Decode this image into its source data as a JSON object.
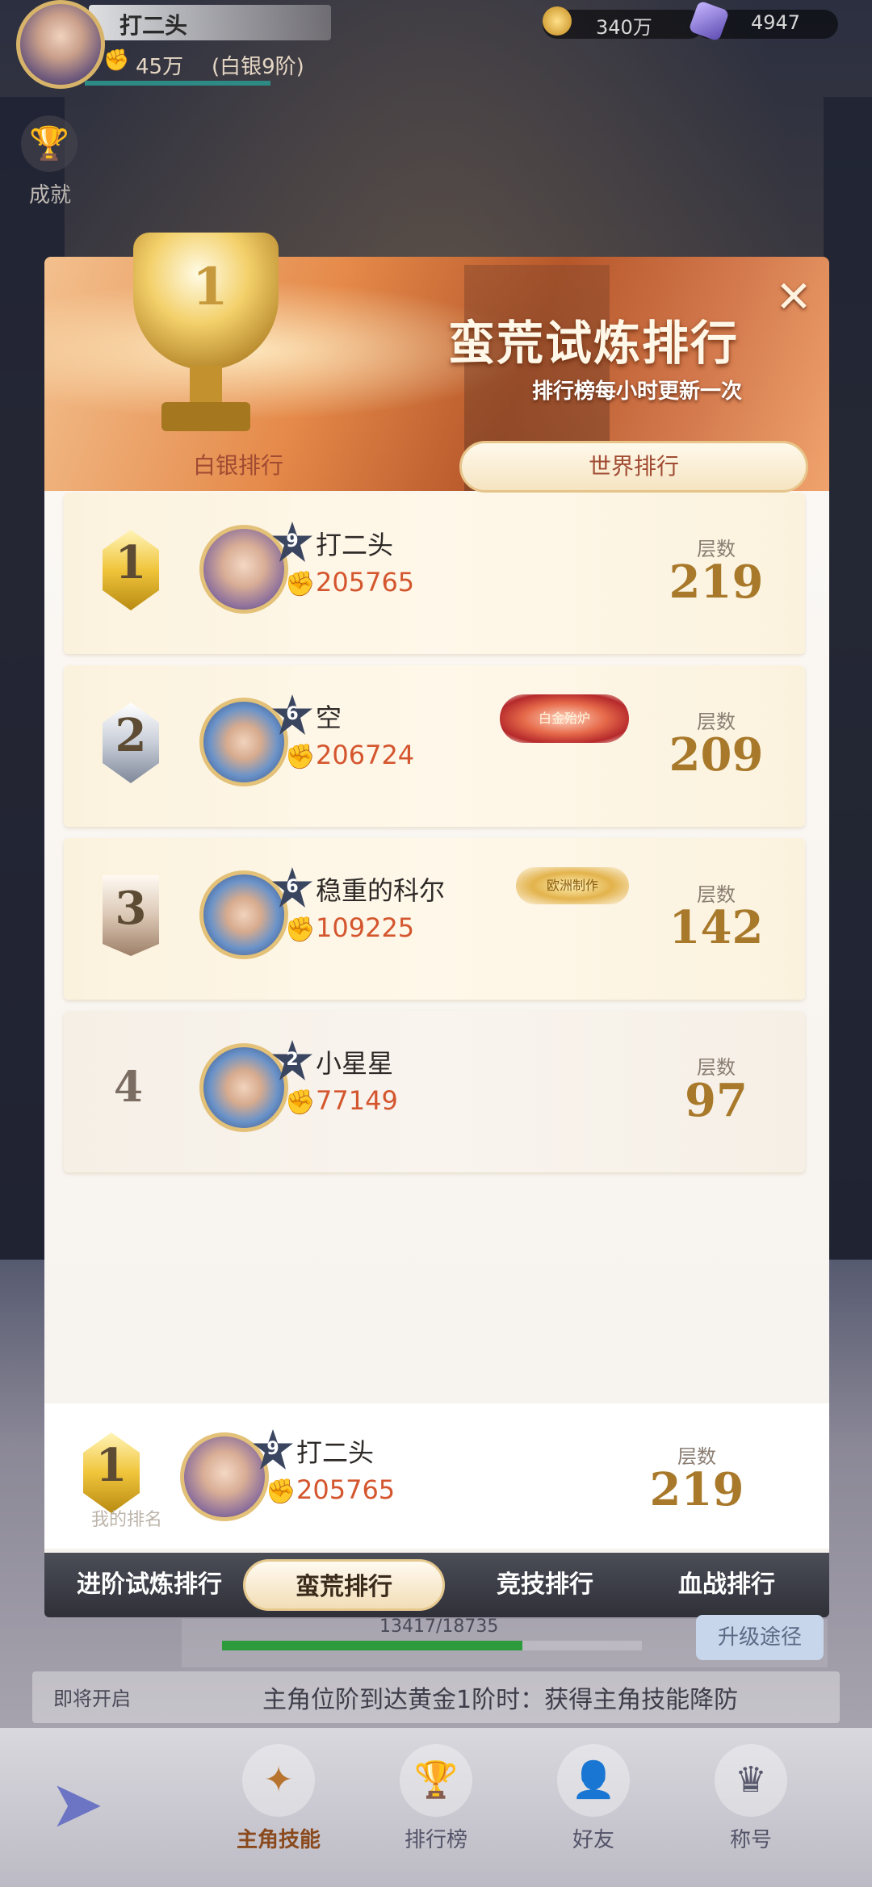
{
  "hud": {
    "player_name": "打二头",
    "power": "45万",
    "rank": "(白银9阶)",
    "gold": "340万",
    "gems": "4947",
    "achievement_label": "成就"
  },
  "modal": {
    "title": "蛮荒试炼排行",
    "subtitle": "排行榜每小时更新一次",
    "close_symbol": "✕",
    "trophy_number": "1",
    "tabs": [
      {
        "label": "白银排行",
        "active": false
      },
      {
        "label": "世界排行",
        "active": true
      }
    ],
    "floor_label": "层数",
    "rows": [
      {
        "rank": "1",
        "vip": "9",
        "name": "打二头",
        "power": "205765",
        "floor": "219",
        "title_badge": ""
      },
      {
        "rank": "2",
        "vip": "6",
        "name": "空",
        "power": "206724",
        "floor": "209",
        "title_badge": "白金殆炉"
      },
      {
        "rank": "3",
        "vip": "6",
        "name": "稳重的科尔",
        "power": "109225",
        "floor": "142",
        "title_badge": "欧洲制作"
      },
      {
        "rank": "4",
        "vip": "2",
        "name": "小星星",
        "power": "77149",
        "floor": "97",
        "title_badge": ""
      }
    ],
    "mine": {
      "rank": "1",
      "vip": "9",
      "name": "打二头",
      "power": "205765",
      "floor": "219",
      "label": "我的排名"
    },
    "bottom_tabs": [
      {
        "label": "进阶试炼排行",
        "active": false
      },
      {
        "label": "蛮荒排行",
        "active": true
      },
      {
        "label": "竞技排行",
        "active": false
      },
      {
        "label": "血战排行",
        "active": false
      }
    ]
  },
  "lower": {
    "xp_text": "13417/18735",
    "xp_fraction": 0.716,
    "upgrade_button": "升级途径",
    "soon_label": "即将开启",
    "soon_text": "主角位阶到达黄金1阶时：获得主角技能降防"
  },
  "nav": {
    "items": [
      {
        "label": "主角技能",
        "icon": "skill-icon",
        "active": true
      },
      {
        "label": "排行榜",
        "icon": "trophy-icon",
        "active": false
      },
      {
        "label": "好友",
        "icon": "friend-icon",
        "active": false
      },
      {
        "label": "称号",
        "icon": "crown-icon",
        "active": false
      }
    ]
  },
  "colors": {
    "accent": "#d4562e",
    "floor_gold": "#a8792a"
  }
}
